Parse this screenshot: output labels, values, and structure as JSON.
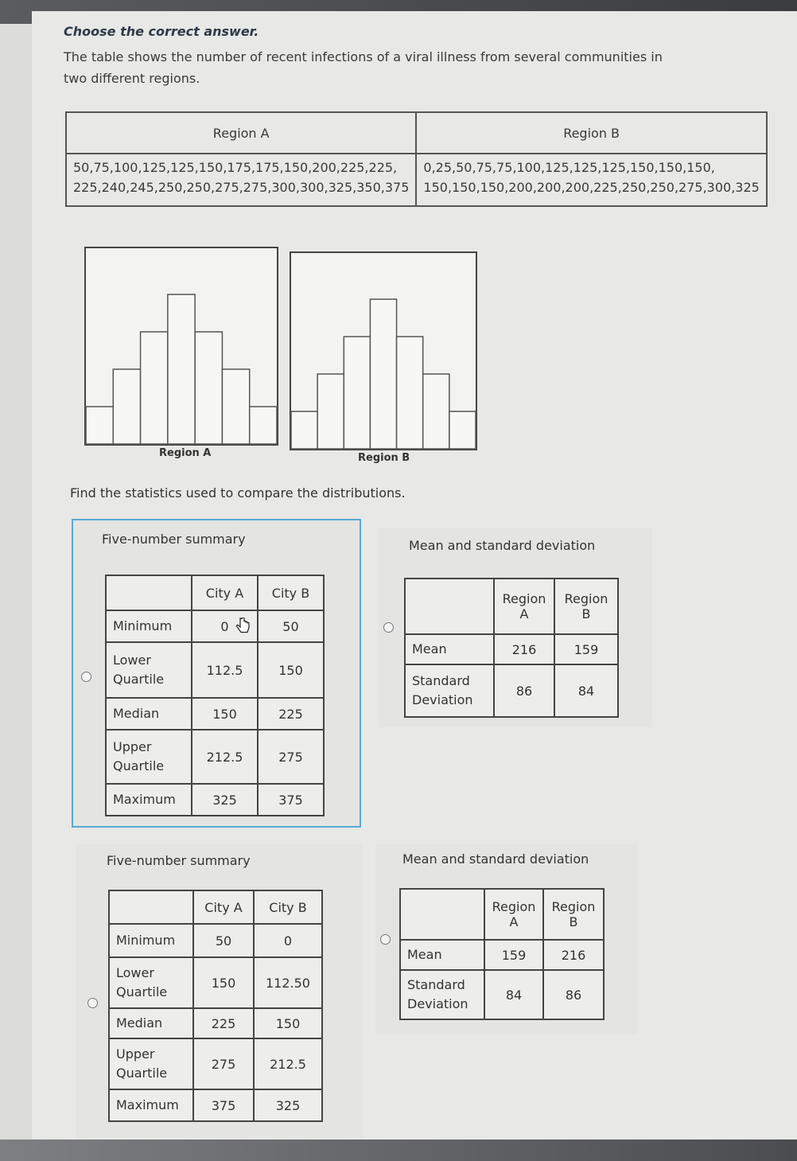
{
  "instruction": "Choose the correct answer.",
  "prompt": "The table shows the number of recent infections of a viral illness from several communities in two different regions.",
  "data_table": {
    "headers": [
      "Region A",
      "Region B"
    ],
    "region_a_values": "50,75,100,125,125,150,175,175,150,200,225,225, 225,240,245,250,250,275,275,300,300,325,350,375",
    "region_b_values": "0,25,50,75,75,100,125,125,125,150,150,150, 150,150,150,200,200,200,225,250,250,275,300,325"
  },
  "chart_data": [
    {
      "type": "bar",
      "title": "",
      "xlabel": "Region A",
      "ylabel": "",
      "values": [
        1,
        2,
        3,
        4,
        3,
        2,
        1
      ]
    },
    {
      "type": "bar",
      "title": "",
      "xlabel": "Region B",
      "ylabel": "",
      "values": [
        1,
        2,
        3,
        4,
        3,
        2,
        1
      ]
    }
  ],
  "question": "Find the statistics used to compare the distributions.",
  "options": [
    {
      "title": "Five-number summary",
      "header": [
        "",
        "City A",
        "City B"
      ],
      "rows": [
        {
          "label": "Minimum",
          "a": "0",
          "b": "50"
        },
        {
          "label": "Lower Quartile",
          "a": "112.5",
          "b": "150"
        },
        {
          "label": "Median",
          "a": "150",
          "b": "225"
        },
        {
          "label": "Upper Quartile",
          "a": "212.5",
          "b": "275"
        },
        {
          "label": "Maximum",
          "a": "325",
          "b": "375"
        }
      ]
    },
    {
      "title": "Mean and standard deviation",
      "header": [
        "",
        "Region A",
        "Region B"
      ],
      "rows": [
        {
          "label": "Mean",
          "a": "216",
          "b": "159"
        },
        {
          "label": "Standard Deviation",
          "a": "86",
          "b": "84"
        }
      ]
    },
    {
      "title": "Five-number summary",
      "header": [
        "",
        "City A",
        "City B"
      ],
      "rows": [
        {
          "label": "Minimum",
          "a": "50",
          "b": "0"
        },
        {
          "label": "Lower Quartile",
          "a": "150",
          "b": "112.50"
        },
        {
          "label": "Median",
          "a": "225",
          "b": "150"
        },
        {
          "label": "Upper Quartile",
          "a": "275",
          "b": "212.5"
        },
        {
          "label": "Maximum",
          "a": "375",
          "b": "325"
        }
      ]
    },
    {
      "title": "Mean and standard deviation",
      "header": [
        "",
        "Region A",
        "Region B"
      ],
      "rows": [
        {
          "label": "Mean",
          "a": "159",
          "b": "216"
        },
        {
          "label": "Standard Deviation",
          "a": "84",
          "b": "86"
        }
      ]
    }
  ],
  "colors": {
    "selected_border": "#5aa8d0",
    "table_border": "#444444"
  }
}
